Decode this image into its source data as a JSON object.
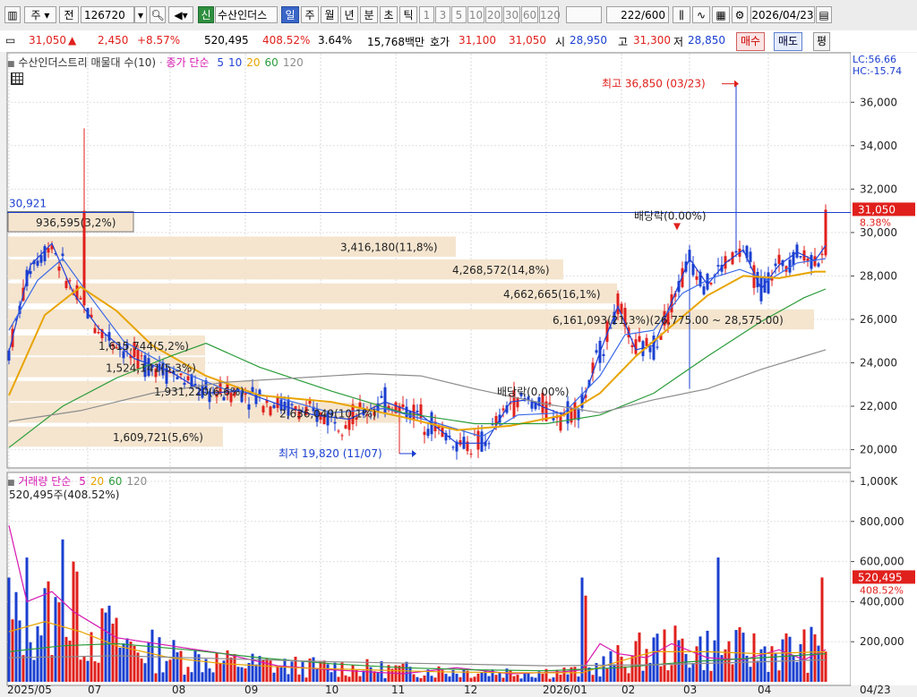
{
  "toolbar": {
    "type_label": "주",
    "prev_label": "전",
    "code": "126720",
    "stock_name": "수산인더스",
    "badge_new": "신",
    "periods": [
      "일",
      "주",
      "월",
      "년",
      "분",
      "초",
      "틱"
    ],
    "active_period": "일",
    "minutes": [
      "1",
      "3",
      "5",
      "10",
      "20",
      "30",
      "60",
      "120"
    ],
    "count": "222",
    "count_total": "/600",
    "date": "2026/04/23"
  },
  "quote": {
    "price": "31,050",
    "arrow": "▲",
    "change": "2,450",
    "change_pct": "+8.57%",
    "volume": "520,495",
    "volume_ratio": "408.52%",
    "turnover": "3.64%",
    "amount": "15,768백만",
    "ask_label": "호가",
    "ask": "31,100",
    "bid": "31,050",
    "open_label": "시",
    "open": "28,950",
    "high_label": "고",
    "high": "31,300",
    "low_label": "저",
    "low": "28,850",
    "buy_label": "매수",
    "sell_label": "매도",
    "avg_label": "평"
  },
  "legend_price": {
    "profile": "수산인더스트리 매물대 수(10)",
    "ma_title": "종가 단순",
    "ma": [
      {
        "n": "5",
        "color": "#1f3fd6"
      },
      {
        "n": "10",
        "color": "#1f3fd6"
      },
      {
        "n": "20",
        "color": "#e8a400"
      },
      {
        "n": "60",
        "color": "#2a9c3a"
      },
      {
        "n": "120",
        "color": "#8c8c8c"
      }
    ]
  },
  "legend_volume": {
    "title": "거래량 단순",
    "ma": [
      {
        "n": "5",
        "color": "#d616b0"
      },
      {
        "n": "20",
        "color": "#e8a400"
      },
      {
        "n": "60",
        "color": "#2a9c3a"
      },
      {
        "n": "120",
        "color": "#8c8c8c"
      }
    ],
    "value": "520,495주(408.52%)"
  },
  "right_info": {
    "lc": "LC:56.66",
    "hc": "HC:-15.74"
  },
  "chart_data": {
    "type": "candlestick",
    "price_axis": {
      "min": 19200,
      "max": 37000,
      "ticks": [
        "36,000",
        "34,000",
        "32,000",
        "30,000",
        "28,000",
        "26,000",
        "24,000",
        "22,000",
        "20,000"
      ]
    },
    "volume_axis": {
      "min": 0,
      "max": 1000000,
      "ticks": [
        "1,000K",
        "800,000",
        "600,000",
        "400,000",
        "200,000"
      ]
    },
    "x_labels": [
      "2025/05",
      "07",
      "08",
      "09",
      "10",
      "11",
      "12",
      "2026/01",
      "02",
      "03",
      "04",
      "04/23"
    ],
    "last_price_tag": {
      "price": "31,050",
      "pct": "8.38%"
    },
    "last_volume_tag": {
      "value": "520,495",
      "pct": "408.52%"
    },
    "ref_line": {
      "label": "30,921",
      "value": 30921
    },
    "annotations": {
      "high": "최고 36,850 (03/23)",
      "low": "최저 19,820 (11/07)",
      "dividend1": "배당락(0.00%)",
      "dividend2": "배당락(0.00%)"
    },
    "volume_profile": [
      {
        "label": "936,595(3,2%)",
        "price": 30500
      },
      {
        "label": "3,416,180(11,8%)",
        "price": 29350
      },
      {
        "label": "4,268,572(14,8%)",
        "price": 28300
      },
      {
        "label": "4,662,665(16,1%)",
        "price": 27200
      },
      {
        "label": "6,161,093(21,3%)(26,775.00 ~ 28,575.00)",
        "price": 26000
      },
      {
        "label": "1,615,744(5,2%)",
        "price": 24800
      },
      {
        "label": "1,524,141(5,3%)",
        "price": 23800
      },
      {
        "label": "1,931,220(6,6%)",
        "price": 22700
      },
      {
        "label": "2,636,049(10,1%)",
        "price": 21700
      },
      {
        "label": "1,609,721(5,6%)",
        "price": 20600
      }
    ],
    "ma_series": [
      {
        "name": "5",
        "color": "#1f3fd6",
        "points": [
          [
            0,
            24500
          ],
          [
            6,
            28500
          ],
          [
            12,
            29500
          ],
          [
            18,
            27200
          ],
          [
            25,
            25600
          ],
          [
            35,
            24200
          ],
          [
            45,
            23600
          ],
          [
            55,
            22600
          ],
          [
            65,
            22700
          ],
          [
            75,
            22100
          ],
          [
            85,
            21600
          ],
          [
            95,
            21400
          ],
          [
            105,
            22200
          ],
          [
            115,
            21600
          ],
          [
            125,
            20300
          ],
          [
            133,
            20300
          ],
          [
            140,
            22200
          ],
          [
            145,
            22300
          ],
          [
            150,
            21900
          ],
          [
            155,
            21600
          ],
          [
            160,
            22100
          ],
          [
            165,
            24500
          ],
          [
            170,
            26600
          ],
          [
            175,
            24600
          ],
          [
            180,
            24800
          ],
          [
            185,
            26800
          ],
          [
            190,
            28800
          ],
          [
            195,
            27600
          ],
          [
            200,
            28600
          ],
          [
            205,
            29200
          ],
          [
            210,
            27400
          ],
          [
            215,
            28500
          ],
          [
            220,
            29100
          ],
          [
            225,
            28700
          ],
          [
            228,
            29400
          ]
        ]
      },
      {
        "name": "10",
        "color": "#3a6ae8",
        "points": [
          [
            0,
            25500
          ],
          [
            8,
            27800
          ],
          [
            15,
            28800
          ],
          [
            22,
            27200
          ],
          [
            32,
            25000
          ],
          [
            45,
            23800
          ],
          [
            60,
            22800
          ],
          [
            75,
            22400
          ],
          [
            90,
            21700
          ],
          [
            105,
            21900
          ],
          [
            120,
            21200
          ],
          [
            132,
            20600
          ],
          [
            142,
            21600
          ],
          [
            155,
            21700
          ],
          [
            165,
            23400
          ],
          [
            172,
            25300
          ],
          [
            180,
            25500
          ],
          [
            188,
            27200
          ],
          [
            196,
            27900
          ],
          [
            204,
            28300
          ],
          [
            212,
            27800
          ],
          [
            220,
            28600
          ],
          [
            228,
            28800
          ]
        ]
      },
      {
        "name": "20",
        "color": "#e8a400",
        "points": [
          [
            0,
            22500
          ],
          [
            10,
            26200
          ],
          [
            20,
            27500
          ],
          [
            30,
            26400
          ],
          [
            40,
            24800
          ],
          [
            55,
            23400
          ],
          [
            70,
            22500
          ],
          [
            90,
            22200
          ],
          [
            110,
            21500
          ],
          [
            125,
            20900
          ],
          [
            140,
            21100
          ],
          [
            155,
            21600
          ],
          [
            165,
            22600
          ],
          [
            175,
            24300
          ],
          [
            185,
            25700
          ],
          [
            195,
            27100
          ],
          [
            205,
            28000
          ],
          [
            215,
            27900
          ],
          [
            225,
            28200
          ],
          [
            228,
            28200
          ]
        ]
      },
      {
        "name": "60",
        "color": "#2a9c3a",
        "points": [
          [
            0,
            20100
          ],
          [
            15,
            22000
          ],
          [
            30,
            23300
          ],
          [
            45,
            24300
          ],
          [
            55,
            24900
          ],
          [
            70,
            23800
          ],
          [
            90,
            22700
          ],
          [
            110,
            21700
          ],
          [
            130,
            21200
          ],
          [
            150,
            21200
          ],
          [
            165,
            21600
          ],
          [
            180,
            22600
          ],
          [
            195,
            24300
          ],
          [
            210,
            25900
          ],
          [
            222,
            27000
          ],
          [
            228,
            27400
          ]
        ]
      },
      {
        "name": "120",
        "color": "#8c8c8c",
        "points": [
          [
            0,
            21300
          ],
          [
            20,
            21800
          ],
          [
            40,
            22600
          ],
          [
            60,
            23100
          ],
          [
            80,
            23300
          ],
          [
            100,
            23500
          ],
          [
            115,
            23400
          ],
          [
            130,
            22800
          ],
          [
            150,
            22100
          ],
          [
            165,
            21700
          ],
          [
            180,
            22300
          ],
          [
            195,
            22800
          ],
          [
            210,
            23700
          ],
          [
            228,
            24600
          ]
        ]
      }
    ],
    "volume_ma_series": [
      {
        "name": "5",
        "color": "#d616b0",
        "points": [
          [
            0,
            780000
          ],
          [
            5,
            400000
          ],
          [
            12,
            450000
          ],
          [
            18,
            350000
          ],
          [
            30,
            220000
          ],
          [
            45,
            180000
          ],
          [
            60,
            140000
          ],
          [
            75,
            80000
          ],
          [
            90,
            60000
          ],
          [
            110,
            40000
          ],
          [
            125,
            70000
          ],
          [
            140,
            40000
          ],
          [
            155,
            50000
          ],
          [
            160,
            60000
          ],
          [
            165,
            190000
          ],
          [
            170,
            140000
          ],
          [
            178,
            120000
          ],
          [
            185,
            190000
          ],
          [
            195,
            120000
          ],
          [
            205,
            110000
          ],
          [
            215,
            160000
          ],
          [
            222,
            110000
          ],
          [
            228,
            160000
          ]
        ]
      },
      {
        "name": "20",
        "color": "#e8a400",
        "points": [
          [
            0,
            250000
          ],
          [
            10,
            300000
          ],
          [
            20,
            250000
          ],
          [
            30,
            180000
          ],
          [
            45,
            120000
          ],
          [
            60,
            90000
          ],
          [
            80,
            70000
          ],
          [
            100,
            60000
          ],
          [
            120,
            50000
          ],
          [
            140,
            45000
          ],
          [
            160,
            45000
          ],
          [
            170,
            100000
          ],
          [
            180,
            150000
          ],
          [
            195,
            150000
          ],
          [
            210,
            140000
          ],
          [
            228,
            150000
          ]
        ]
      },
      {
        "name": "60",
        "color": "#2a9c3a",
        "points": [
          [
            0,
            150000
          ],
          [
            15,
            180000
          ],
          [
            30,
            190000
          ],
          [
            50,
            160000
          ],
          [
            70,
            120000
          ],
          [
            90,
            90000
          ],
          [
            110,
            70000
          ],
          [
            130,
            60000
          ],
          [
            150,
            55000
          ],
          [
            170,
            70000
          ],
          [
            190,
            100000
          ],
          [
            210,
            120000
          ],
          [
            228,
            140000
          ]
        ]
      },
      {
        "name": "120",
        "color": "#8c8c8c",
        "points": [
          [
            0,
            120000
          ],
          [
            30,
            130000
          ],
          [
            60,
            115000
          ],
          [
            90,
            100000
          ],
          [
            120,
            90000
          ],
          [
            150,
            80000
          ],
          [
            180,
            85000
          ],
          [
            210,
            100000
          ],
          [
            228,
            110000
          ]
        ]
      }
    ]
  }
}
